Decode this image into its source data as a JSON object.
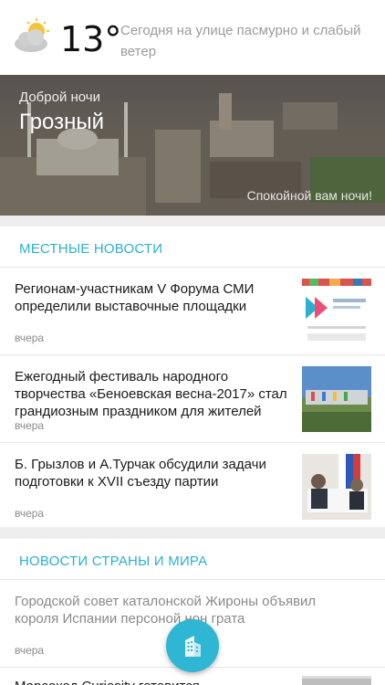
{
  "weather": {
    "temperature": "13°",
    "description": "Сегодня на улице пасмурно и слабый ветер",
    "icon": "cloudy-sun-icon"
  },
  "hero": {
    "greeting": "Доброй ночи",
    "city": "Грозный",
    "wish": "Спокойной вам ночи!"
  },
  "local_news": {
    "section_title": "МЕСТНЫЕ НОВОСТИ",
    "items": [
      {
        "title": "Регионам-участникам V Форума СМИ определили выставочные площадки",
        "time": "вчера"
      },
      {
        "title": "Ежегодный фестиваль народного творчества «Беноевская весна-2017» стал грандиозным праздником для жителей",
        "time": "вчера"
      },
      {
        "title": "Б. Грызлов и А.Турчак обсудили задачи подготовки к XVII съезду партии",
        "time": "вчера"
      }
    ]
  },
  "world_news": {
    "section_title": "НОВОСТИ СТРАНЫ И МИРА",
    "items": [
      {
        "title": "Городской совет каталонской Жироны объявил короля Испании персоной нон грата",
        "time": "вчера"
      },
      {
        "title": "Марсоход Curiosity готовится",
        "time": ""
      }
    ]
  },
  "fab": {
    "icon": "buildings-icon"
  }
}
